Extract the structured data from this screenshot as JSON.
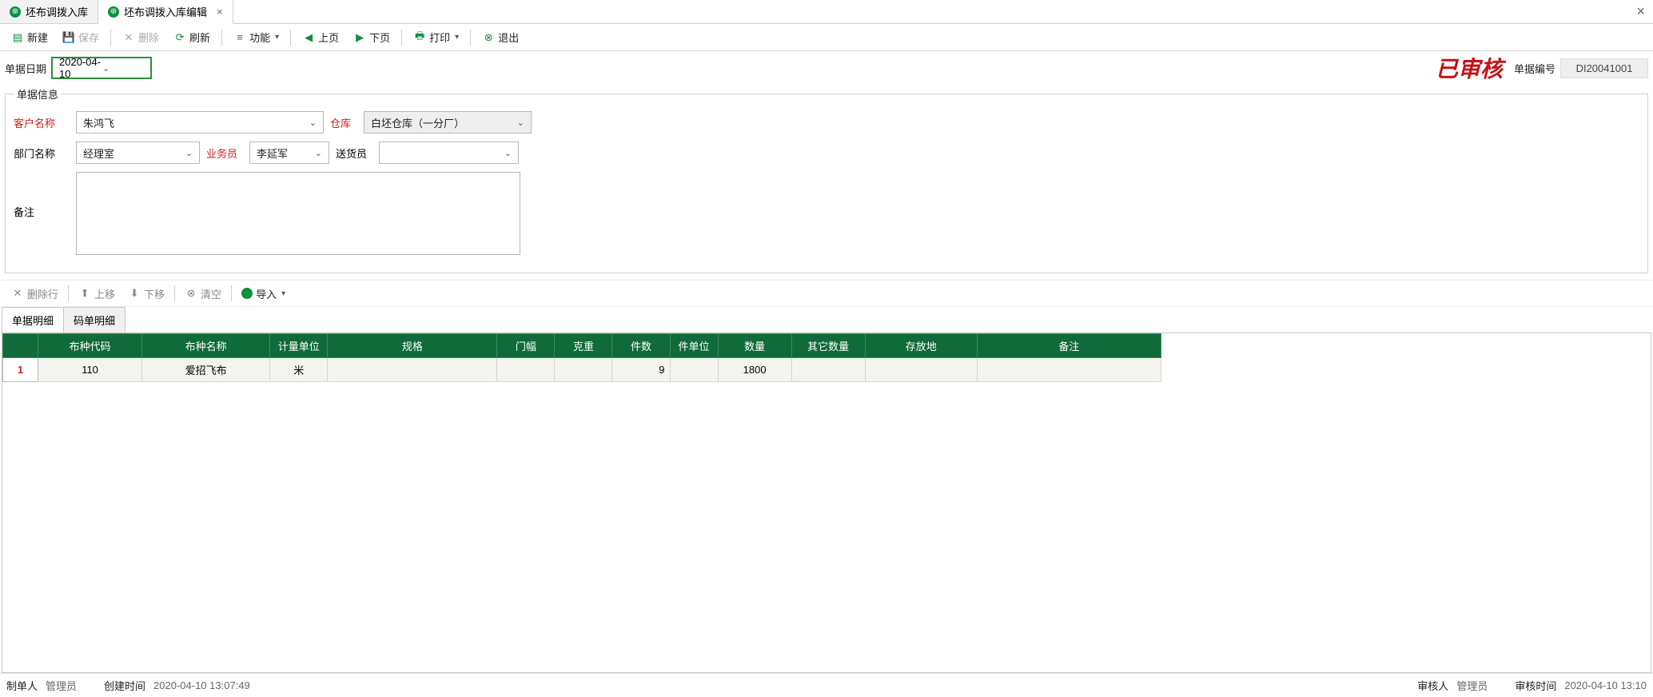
{
  "tabs": [
    {
      "label": "坯布调拨入库",
      "active": false
    },
    {
      "label": "坯布调拨入库编辑",
      "active": true
    }
  ],
  "toolbar": {
    "new": "新建",
    "save": "保存",
    "delete": "删除",
    "refresh": "刷新",
    "function": "功能",
    "prev": "上页",
    "next": "下页",
    "print": "打印",
    "exit": "退出"
  },
  "doc": {
    "date_label": "单据日期",
    "date_value": "2020-04-10",
    "stamp": "已审核",
    "docno_label": "单据编号",
    "docno_value": "DI20041001"
  },
  "info": {
    "legend": "单据信息",
    "customer_label": "客户名称",
    "customer_value": "朱鸿飞",
    "warehouse_label": "仓库",
    "warehouse_value": "白坯仓库（一分厂）",
    "dept_label": "部门名称",
    "dept_value": "经理室",
    "sales_label": "业务员",
    "sales_value": "李延军",
    "deliver_label": "送货员",
    "deliver_value": "",
    "remarks_label": "备注",
    "remarks_value": ""
  },
  "row_toolbar": {
    "del_row": "删除行",
    "move_up": "上移",
    "move_down": "下移",
    "clear": "清空",
    "import": "导入"
  },
  "detail_tabs": [
    {
      "label": "单据明细",
      "active": true
    },
    {
      "label": "码单明细",
      "active": false
    }
  ],
  "grid": {
    "headers": [
      "",
      "布种代码",
      "布种名称",
      "计量单位",
      "规格",
      "门幅",
      "克重",
      "件数",
      "件单位",
      "数量",
      "其它数量",
      "存放地",
      "备注"
    ],
    "widths": [
      44,
      130,
      160,
      72,
      212,
      72,
      72,
      72,
      60,
      92,
      92,
      140,
      230
    ],
    "rows": [
      {
        "n": "1",
        "code": "110",
        "name": "爱招飞布",
        "unit": "米",
        "spec": "",
        "width": "",
        "weight": "",
        "pieces": "9",
        "piece_unit": "",
        "qty": "1800",
        "other_qty": "",
        "location": "",
        "remark": ""
      }
    ]
  },
  "status": {
    "creator_label": "制单人",
    "creator_value": "管理员",
    "created_label": "创建时间",
    "created_value": "2020-04-10 13:07:49",
    "auditor_label": "审核人",
    "auditor_value": "管理员",
    "audited_label": "审核时间",
    "audited_value": "2020-04-10 13:10"
  }
}
